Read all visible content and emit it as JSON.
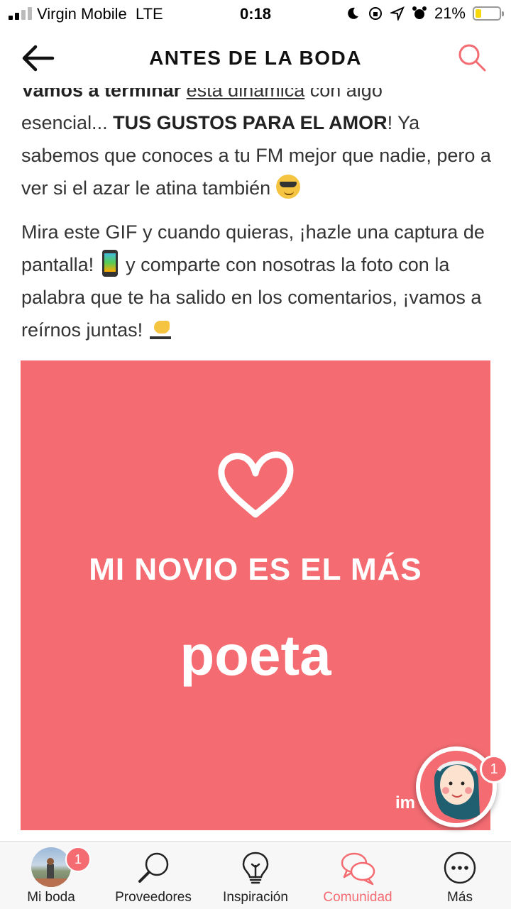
{
  "status_bar": {
    "carrier": "Virgin Mobile",
    "network": "LTE",
    "time": "0:18",
    "battery": "21%",
    "battery_fraction": 0.21
  },
  "header": {
    "title": "ANTES DE LA BODA",
    "back_icon": "arrow-left-icon",
    "search_icon": "search-icon"
  },
  "post": {
    "p1_partial_bold": "Vamos a terminar",
    "p1_partial_link": "esta dinámica",
    "p1_partial_rest": "con algo",
    "p1_text_a": "esencial... ",
    "p1_bold": "TUS GUSTOS PARA EL AMOR",
    "p1_text_b": "! Ya sabemos que conoces a tu FM mejor que nadie, pero a ver si el azar le atina también ",
    "p2_text_a": "Mira este GIF y cuando quieras, ¡hazle una captura de pantalla! ",
    "p2_text_b": " y comparte con nosotras la foto con la palabra que te ha salido en los comentarios, ¡vamos a reírnos juntas! ",
    "gif": {
      "line1": "MI NOVIO ES EL MÁS",
      "line2": "poeta",
      "watermark": "im",
      "background": "#f46c72"
    }
  },
  "floating_chat": {
    "badge": "1"
  },
  "nav": {
    "items": [
      {
        "label": "Mi boda",
        "badge": "1",
        "icon": "profile-photo-icon"
      },
      {
        "label": "Proveedores",
        "icon": "magnifier-icon"
      },
      {
        "label": "Inspiración",
        "icon": "lightbulb-icon"
      },
      {
        "label": "Comunidad",
        "icon": "chat-bubbles-icon",
        "active": true
      },
      {
        "label": "Más",
        "icon": "more-dots-icon"
      }
    ],
    "accent": "#f46c72"
  }
}
